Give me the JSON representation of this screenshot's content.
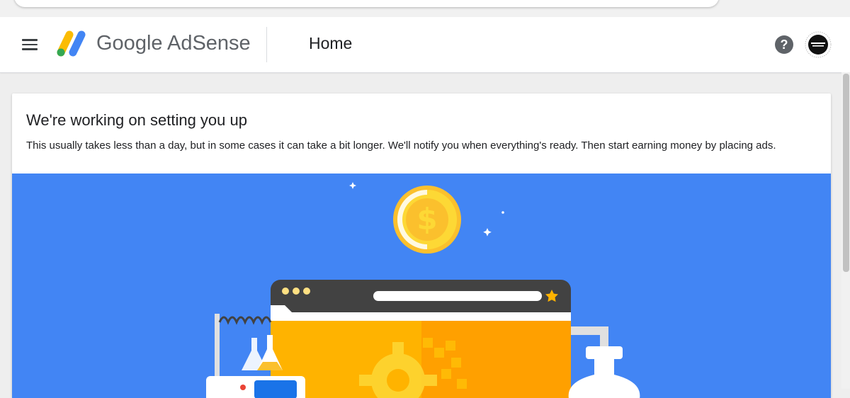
{
  "app": {
    "brand_name": "Google AdSense",
    "page_title": "Home",
    "help_icon": "help-icon",
    "avatar_label": "account-avatar"
  },
  "setup_card": {
    "title": "We're working on setting you up",
    "body": "This usually takes less than a day, but in some cases it can take a bit longer. We'll notify you when everything's ready. Then start earning money by placing ads."
  },
  "colors": {
    "illustration_bg": "#4285f4",
    "coin": "#fdd835",
    "browser_frame": "#424242",
    "browser_content": "#ffb300",
    "star": "#ffb300"
  }
}
